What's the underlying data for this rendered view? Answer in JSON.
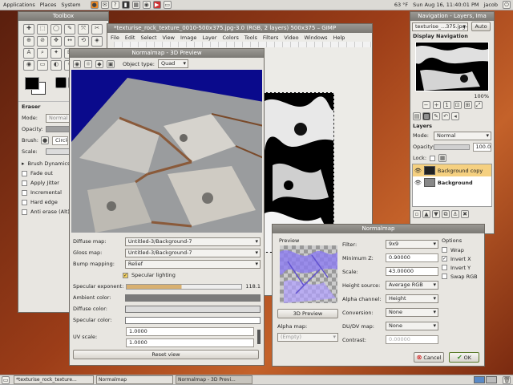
{
  "top_panel": {
    "menus": [
      "Applications",
      "Places",
      "System"
    ],
    "temperature": "63 °F",
    "clock": "Sun Aug 16, 11:40:01 PM",
    "user": "jacob"
  },
  "toolbox": {
    "title": "Toolbox",
    "tools": [
      "✚",
      "⬚",
      "◯",
      "✎",
      "⤧",
      "✂",
      "⊕",
      "⊘",
      "✥",
      "↔",
      "⟲",
      "◈",
      "A",
      "⌕",
      "✦",
      "⊞",
      "✐",
      "⌫",
      "◉",
      "▭",
      "◐",
      "✷",
      "⚒",
      "☼"
    ],
    "eraser_label": "Eraser",
    "mode_label": "Mode:",
    "mode_value": "Normal",
    "opacity_label": "Opacity:",
    "brush_label": "Brush:",
    "brush_value": "Circle",
    "scale_label": "Scale:",
    "options": [
      "Brush Dynamics",
      "Fade out",
      "Apply Jitter",
      "Incremental",
      "Hard edge",
      "Anti erase (Alt)"
    ]
  },
  "image_window": {
    "title": "*texturise_rock_texture_0010-500x375.jpg-3.0 (RGB, 2 layers) 500x375 – GIMP",
    "menu": [
      "File",
      "Edit",
      "Select",
      "View",
      "Image",
      "Layer",
      "Colors",
      "Tools",
      "Filters",
      "Video",
      "Windows",
      "Help"
    ]
  },
  "preview3d": {
    "title": "Normalmap - 3D Preview",
    "object_type_label": "Object type:",
    "object_type_value": "Quad",
    "diffuse_map_label": "Diffuse map:",
    "diffuse_map_value": "Untitled-3/Background-7",
    "gloss_map_label": "Gloss map:",
    "gloss_map_value": "Untitled-3/Background-7",
    "bump_mapping_label": "Bump mapping:",
    "bump_mapping_value": "Relief",
    "specular_lighting_label": "Specular lighting",
    "specular_exponent_label": "Specular exponent:",
    "specular_exponent_value": "118.1",
    "ambient_color_label": "Ambient color:",
    "diffuse_color_label": "Diffuse color:",
    "specular_color_label": "Specular color:",
    "uv_scale_label": "UV scale:",
    "uv_scale_1": "1.0000",
    "uv_scale_2": "1.0000",
    "reset_view_label": "Reset view",
    "colors": {
      "sky": "#0a0a8c",
      "ambient": "#7a7a7a",
      "diffuse": "#dcdcdc",
      "specular": "#ffffff"
    }
  },
  "normalmap": {
    "title": "Normalmap",
    "preview_label": "Preview",
    "preview_3d_button": "3D Preview",
    "alpha_map_label": "Alpha map:",
    "alpha_map_value": "(Empty)",
    "filter_label": "Filter:",
    "filter_value": "9x9",
    "min_z_label": "Minimum Z:",
    "min_z_value": "0.90000",
    "scale_label": "Scale:",
    "scale_value": "43.00000",
    "height_source_label": "Height source:",
    "height_source_value": "Average RGB",
    "alpha_channel_label": "Alpha channel:",
    "alpha_channel_value": "Height",
    "conversion_label": "Conversion:",
    "conversion_value": "None",
    "dudv_map_label": "DU/DV map:",
    "dudv_map_value": "None",
    "contrast_label": "Contrast:",
    "contrast_value": "0.00000",
    "options_label": "Options",
    "wrap_label": "Wrap",
    "invert_x_label": "Invert X",
    "invert_y_label": "Invert Y",
    "swap_rgb_label": "Swap RGB",
    "cancel_label": "Cancel",
    "ok_label": "OK"
  },
  "dock": {
    "title": "Navigation - Layers, Ima",
    "image_combo": "texturise_...375.jpg-3",
    "auto_label": "Auto",
    "display_navigation_label": "Display Navigation",
    "zoom_value": "100%",
    "layers_label": "Layers",
    "mode_label": "Mode:",
    "mode_value": "Normal",
    "opacity_label": "Opacity:",
    "opacity_value": "100.0",
    "lock_label": "Lock:",
    "layers": [
      "Background copy",
      "Background"
    ]
  },
  "taskbar": {
    "items": [
      "*texturise_rock_texture...",
      "Normalmap",
      "Normalmap - 3D Previ..."
    ]
  }
}
